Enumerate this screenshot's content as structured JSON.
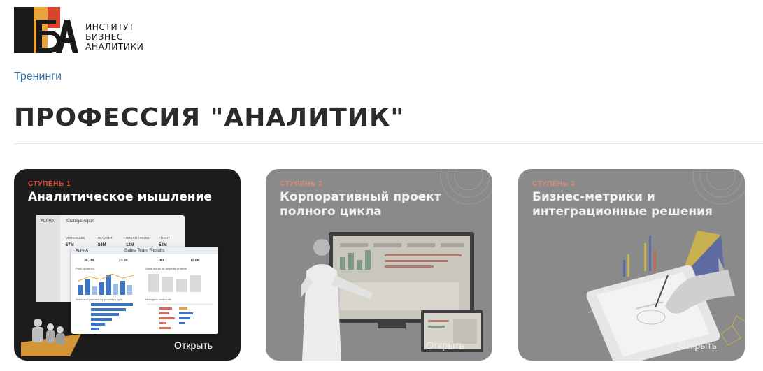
{
  "logo": {
    "line1": "ИНСТИТУТ",
    "line2": "БИЗНЕС",
    "line3": "АНАЛИТИКИ",
    "mark_letters": "ИБА",
    "colors": {
      "black": "#1a1a1a",
      "orange": "#e8a33c",
      "red": "#d9442c"
    }
  },
  "breadcrumb": {
    "label": "Тренинги"
  },
  "page": {
    "title": "ПРОФЕССИЯ \"АНАЛИТИК\""
  },
  "cards": [
    {
      "step": "СТУПЕНЬ 1",
      "title": "Аналитическое мышление",
      "open_label": "Открыть",
      "dashboard": {
        "brand": "ALPHA",
        "report_title": "Strategic report",
        "results_title": "Sales Team Results",
        "kpis": [
          "VERSAILLES",
          "DIAMONT",
          "DREAM HOUSE",
          "FLIGHT"
        ],
        "kpi_values": [
          "57M",
          "84M",
          "12M",
          "52M"
        ],
        "totals": [
          "34.2M",
          "23.3K",
          "2K8",
          "12.6K"
        ],
        "panels": [
          "Profit dynamics",
          "Sales actual on target by projects",
          "Sales and payment by property's type",
          "Managers' sales rate"
        ]
      }
    },
    {
      "step": "СТУПЕНЬ 2",
      "title": "Корпоративный проект полного цикла",
      "open_label": "Открыть"
    },
    {
      "step": "СТУПЕНЬ 3",
      "title": "Бизнес-метрики и интеграционные решения",
      "open_label": "Открыть"
    }
  ]
}
